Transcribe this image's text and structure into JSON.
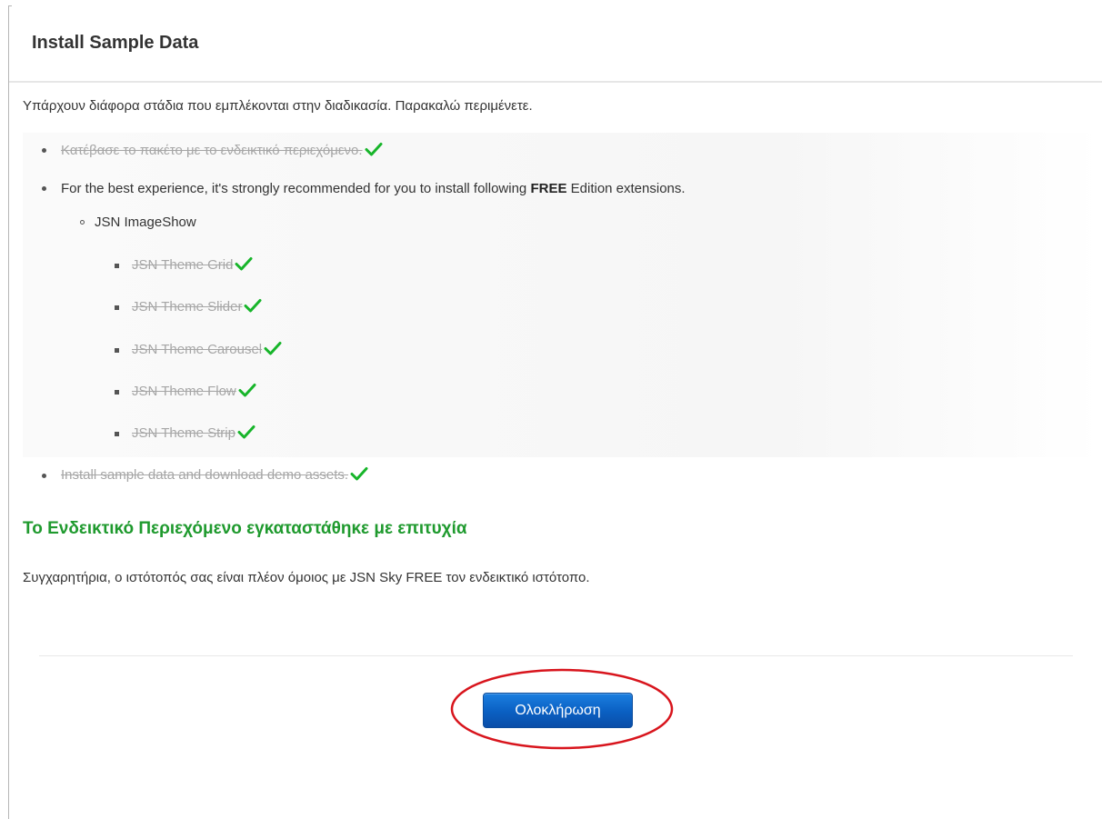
{
  "modal": {
    "title": "Install Sample Data",
    "intro": "Υπάρχουν διάφορα στάδια που εμπλέκονται στην διαδικασία. Παρακαλώ περιμένετε."
  },
  "steps": {
    "download_package": "Κατέβασε το πακέτο με το ενδεικτικό περιεχόμενο.",
    "recommend_prefix": "For the best experience, it's strongly recommended for you to install following ",
    "recommend_strong": "FREE",
    "recommend_suffix": " Edition extensions.",
    "extension_name": "JSN ImageShow",
    "themes": [
      "JSN Theme Grid",
      "JSN Theme Slider",
      "JSN Theme Carousel",
      "JSN Theme Flow",
      "JSN Theme Strip"
    ],
    "install_sample": "Install sample data and download demo assets."
  },
  "result": {
    "success_title": "Το Ενδεικτικό Περιεχόμενο εγκαταστάθηκε με επιτυχία",
    "congrats": "Συγχαρητήρια, ο ιστότοπός σας είναι πλέον όμοιος με JSN Sky FREE τον ενδεικτικό ιστότοπο."
  },
  "footer": {
    "finish_label": "Ολοκλήρωση"
  },
  "colors": {
    "success_green": "#1f9a2e",
    "check_green": "#17b52a",
    "button_blue": "#0a5fc2",
    "highlight_red": "#d8151d"
  },
  "icons": {
    "check": "check-icon"
  }
}
